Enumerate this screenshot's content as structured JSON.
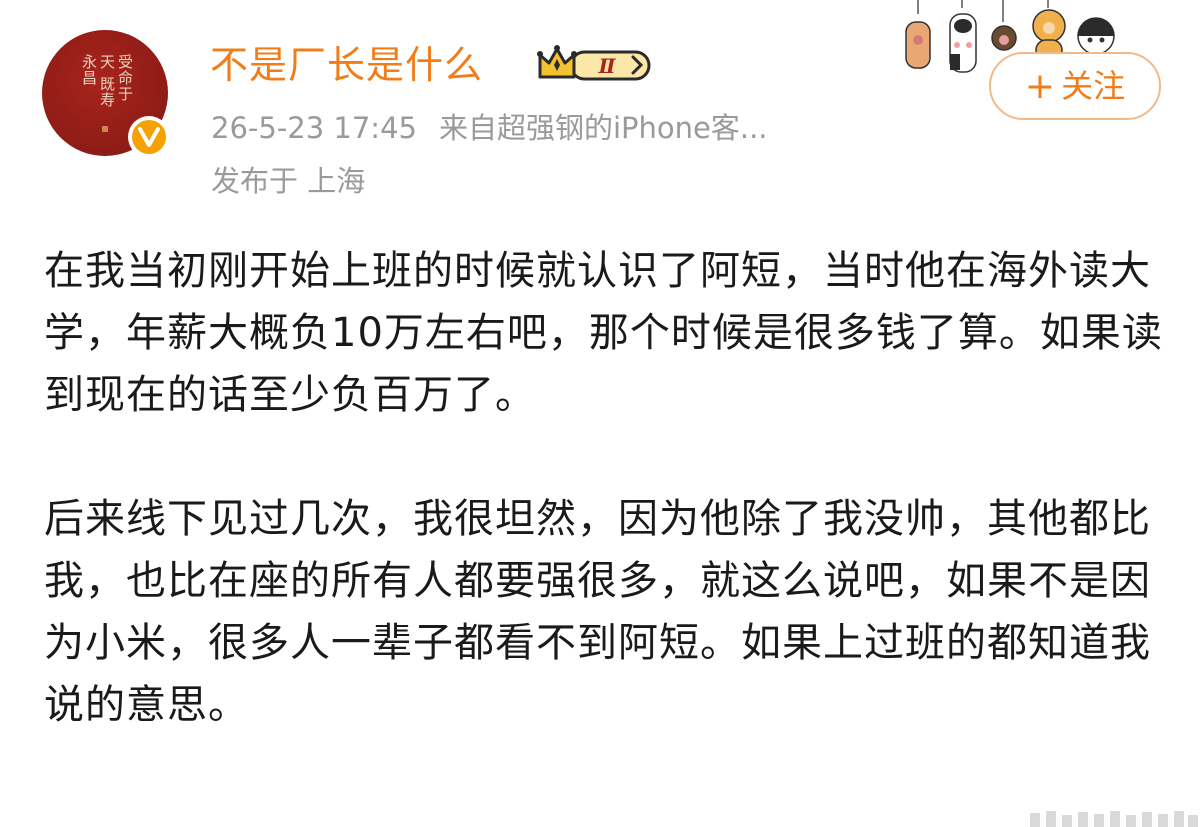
{
  "header": {
    "username": "不是厂长是什么",
    "vip_level": "Ⅱ",
    "timestamp": "26-5-23 17:45",
    "source": "来自超强钢的iPhone客...",
    "location": "发布于 上海",
    "follow_label": "关注",
    "follow_plus": "+",
    "avatar_text": "受命于天 既寿永昌"
  },
  "post": {
    "paragraphs": [
      "在我当初刚开始上班的时候就认识了阿短，当时他在海外读大学，年薪大概负10万左右吧，那个时候是很多钱了算。如果读到现在的话至少负百万了。",
      "后来线下见过几次，我很坦然，因为他除了我没帅，其他都比我，也比在座的所有人都要强很多，就这么说吧，如果不是因为小米，很多人一辈子都看不到阿短。如果上过班的都知道我说的意思。"
    ]
  },
  "icons": {
    "verified": "verified-v-icon",
    "vip": "crown-icon",
    "cats": "cat-paw-decoration-icon",
    "watermark": "watermark-icon"
  },
  "colors": {
    "accent": "#f07d1a",
    "meta": "#9a9a9a",
    "avatar_red": "#8e1c16",
    "verified_gold": "#f5a100"
  }
}
